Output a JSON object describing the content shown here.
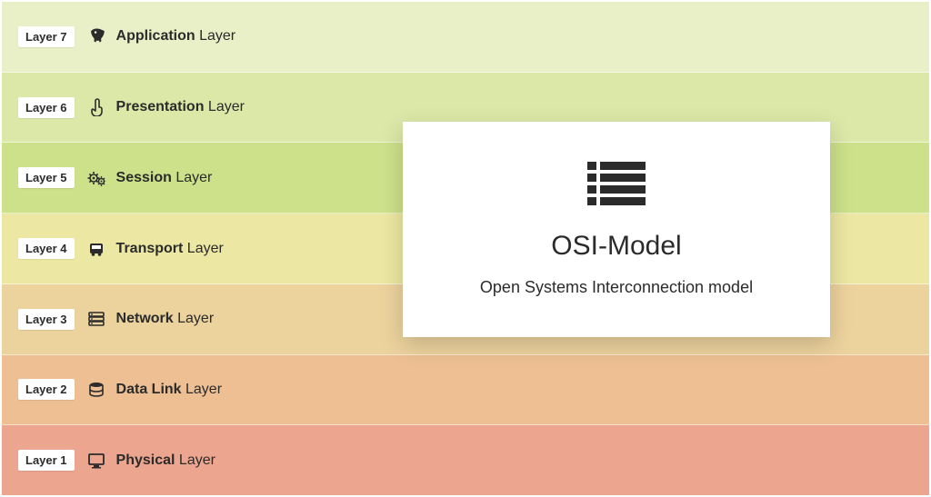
{
  "layers": [
    {
      "badge": "Layer 7",
      "name": "Application",
      "suffix": " Layer",
      "icon": "rocket-icon",
      "color": "#e9efc6"
    },
    {
      "badge": "Layer 6",
      "name": "Presentation",
      "suffix": " Layer",
      "icon": "pointer-icon",
      "color": "#dce8a8"
    },
    {
      "badge": "Layer 5",
      "name": "Session",
      "suffix": " Layer",
      "icon": "gears-icon",
      "color": "#cde18a"
    },
    {
      "badge": "Layer 4",
      "name": "Transport",
      "suffix": " Layer",
      "icon": "bus-icon",
      "color": "#ece7a2"
    },
    {
      "badge": "Layer 3",
      "name": "Network",
      "suffix": " Layer",
      "icon": "server-icon",
      "color": "#ecd29d"
    },
    {
      "badge": "Layer 2",
      "name": "Data Link",
      "suffix": " Layer",
      "icon": "database-icon",
      "color": "#edbf93"
    },
    {
      "badge": "Layer 1",
      "name": "Physical",
      "suffix": " Layer",
      "icon": "desktop-icon",
      "color": "#eca58e"
    }
  ],
  "card": {
    "title": "OSI-Model",
    "subtitle": "Open Systems Interconnection model"
  }
}
